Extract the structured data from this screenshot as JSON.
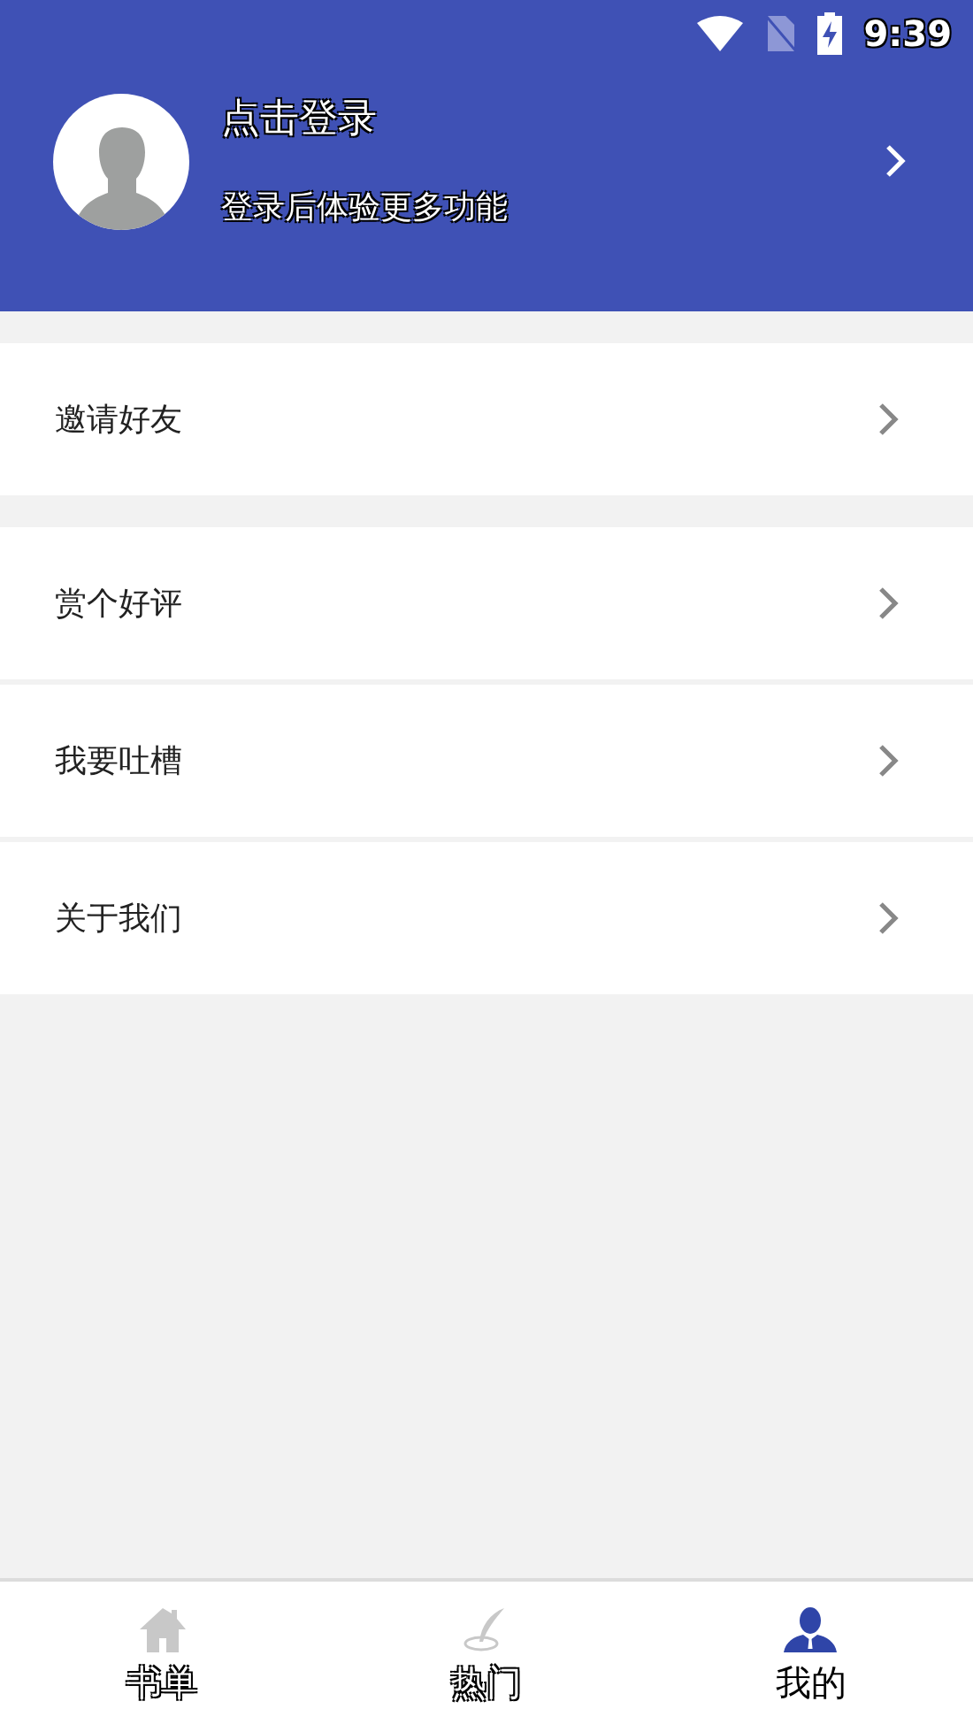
{
  "status_bar": {
    "time": "9:39"
  },
  "profile": {
    "title": "点击登录",
    "subtitle": "登录后体验更多功能"
  },
  "menu_groups": [
    {
      "items": [
        {
          "label": "邀请好友"
        }
      ]
    },
    {
      "items": [
        {
          "label": "赏个好评"
        },
        {
          "label": "我要吐槽"
        },
        {
          "label": "关于我们"
        }
      ]
    }
  ],
  "bottom_nav": [
    {
      "label": "书单",
      "kind": "home",
      "selected": false
    },
    {
      "label": "热门",
      "kind": "feather",
      "selected": false
    },
    {
      "label": "我的",
      "kind": "person",
      "selected": true
    }
  ]
}
